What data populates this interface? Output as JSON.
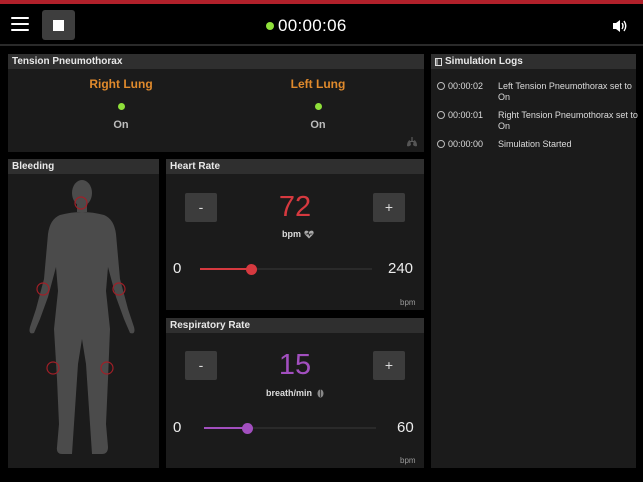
{
  "header": {
    "timer": "00:00:06",
    "icons": [
      "menu-icon",
      "stop-icon",
      "speaker-icon"
    ],
    "timer_dot_color": "#8fe03a",
    "accent_color": "#b0202a"
  },
  "tension": {
    "title": "Tension Pneumothorax",
    "right": {
      "label": "Right Lung",
      "state": "On"
    },
    "left": {
      "label": "Left Lung",
      "state": "On"
    }
  },
  "logs": {
    "title": "Simulation Logs",
    "entries": [
      {
        "time": "00:00:02",
        "message": "Left Tension Pneumothorax set to On"
      },
      {
        "time": "00:00:01",
        "message": "Right Tension Pneumothorax set to On"
      },
      {
        "time": "00:00:00",
        "message": "Simulation Started"
      }
    ]
  },
  "bleeding": {
    "title": "Bleeding"
  },
  "heart_rate": {
    "title": "Heart Rate",
    "minus": "-",
    "plus": "+",
    "value": "72",
    "unit": "bpm",
    "min": "0",
    "max": "240",
    "corner_unit": "bpm",
    "level": 0.3,
    "color": "#d6393f"
  },
  "resp_rate": {
    "title": "Respiratory Rate",
    "minus": "-",
    "plus": "+",
    "value": "15",
    "unit": "breath/min",
    "min": "0",
    "max": "60",
    "corner_unit": "bpm",
    "level": 0.25,
    "color": "#a24fbf"
  }
}
